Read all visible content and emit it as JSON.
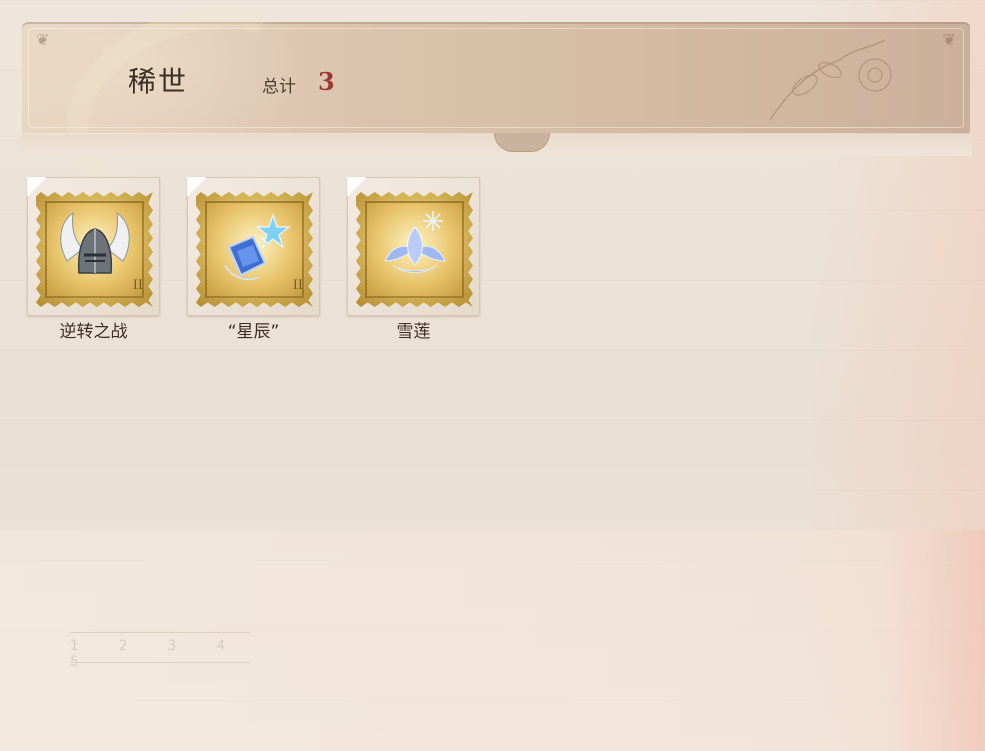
{
  "header": {
    "title": "稀世",
    "total_label": "总计",
    "total_count": "3"
  },
  "items": [
    {
      "name": "逆转之战",
      "icon": "winged-helmet-icon",
      "value_mark": "II"
    },
    {
      "name": "“星辰”",
      "icon": "star-crystal-icon",
      "value_mark": "II"
    },
    {
      "name": "雪莲",
      "icon": "snow-lotus-icon",
      "value_mark": ""
    }
  ],
  "decor": {
    "ruler_digits": "1 2 3 4 5"
  },
  "colors": {
    "count_accent": "#9a3a34",
    "text_primary": "#3d2e25",
    "stamp_gold": "#d6b458"
  }
}
